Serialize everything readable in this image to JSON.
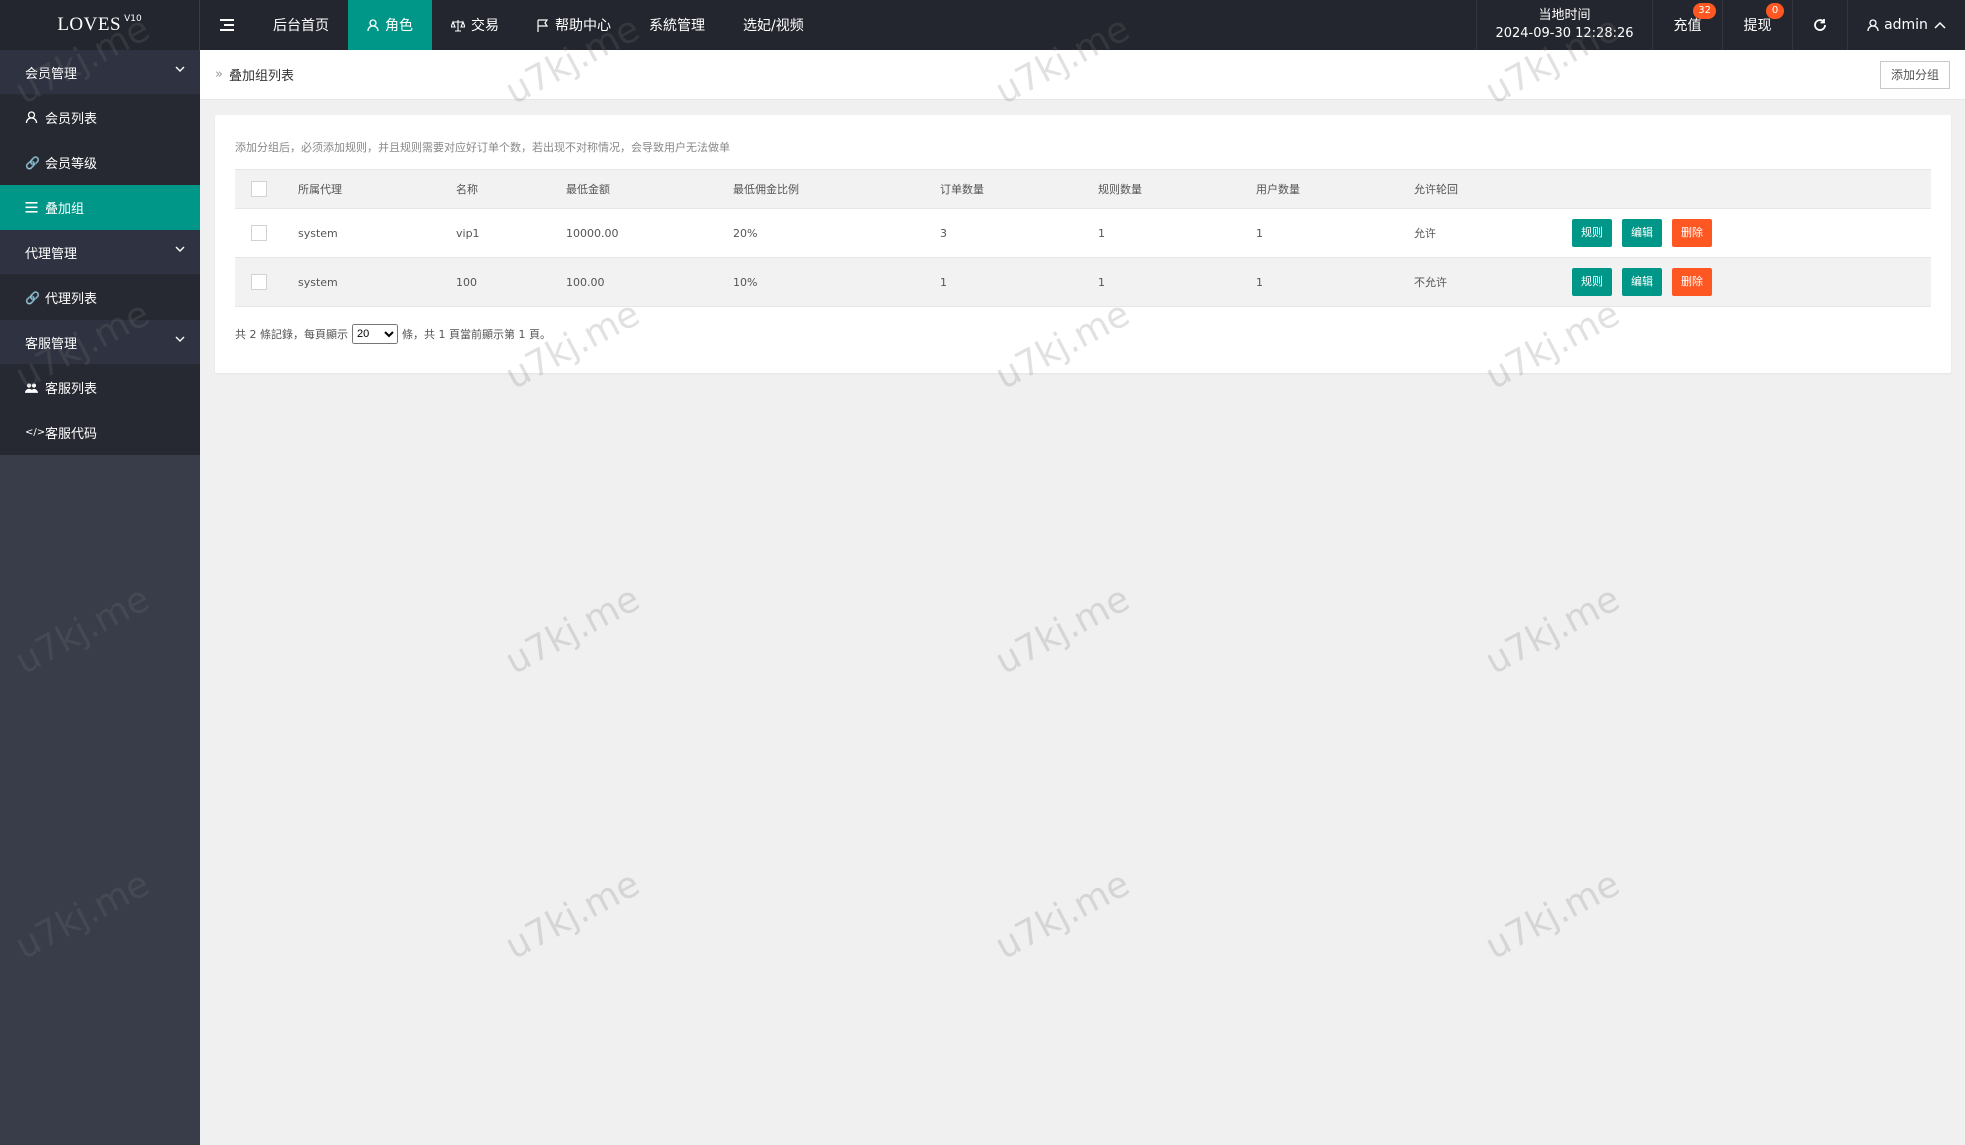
{
  "logo": {
    "text": "LOVES",
    "version": "V10"
  },
  "nav": [
    {
      "label": "后台首页",
      "icon": ""
    },
    {
      "label": "角色",
      "icon": "user-icon",
      "active": true
    },
    {
      "label": "交易",
      "icon": "scale-icon"
    },
    {
      "label": "帮助中心",
      "icon": "flag-icon"
    },
    {
      "label": "系統管理",
      "icon": ""
    },
    {
      "label": "选妃/视频",
      "icon": ""
    }
  ],
  "header": {
    "time_label": "当地时间",
    "time_value": "2024-09-30 12:28:26",
    "recharge_label": "充值",
    "recharge_badge": "32",
    "withdraw_label": "提现",
    "withdraw_badge": "0",
    "admin_label": "admin"
  },
  "sidebar": {
    "groups": [
      {
        "label": "会员管理",
        "items": [
          {
            "label": "会员列表",
            "icon": "user-icon"
          },
          {
            "label": "会员等级",
            "icon": "link-icon"
          },
          {
            "label": "叠加组",
            "icon": "list-icon",
            "active": true
          }
        ]
      },
      {
        "label": "代理管理",
        "items": [
          {
            "label": "代理列表",
            "icon": "link-icon"
          }
        ]
      },
      {
        "label": "客服管理",
        "items": [
          {
            "label": "客服列表",
            "icon": "users-icon"
          },
          {
            "label": "客服代码",
            "icon": "code-icon"
          }
        ]
      }
    ]
  },
  "breadcrumb": {
    "title": "叠加组列表",
    "add_button": "添加分组"
  },
  "main": {
    "tip": "添加分组后，必须添加规则，并且规则需要对应好订单个数，若出现不对称情况，会导致用户无法做单",
    "columns": [
      "所属代理",
      "名称",
      "最低金额",
      "最低佣金比例",
      "订单数量",
      "规则数量",
      "用户数量",
      "允许轮回"
    ],
    "rows": [
      [
        "system",
        "vip1",
        "10000.00",
        "20%",
        "3",
        "1",
        "1",
        "允许"
      ],
      [
        "system",
        "100",
        "100.00",
        "10%",
        "1",
        "1",
        "1",
        "不允许"
      ]
    ],
    "row_actions": {
      "rule": "规则",
      "edit": "编辑",
      "delete": "删除"
    },
    "pager": {
      "before": "共 2 條記錄，每頁顯示",
      "select_value": "20",
      "after": "條，共 1 頁當前顯示第 1 頁。"
    }
  },
  "watermark": "u7kj.me",
  "colors": {
    "accent": "#009688",
    "danger": "#ff5722",
    "topbar": "#23262e",
    "sidebar": "#393d49"
  }
}
